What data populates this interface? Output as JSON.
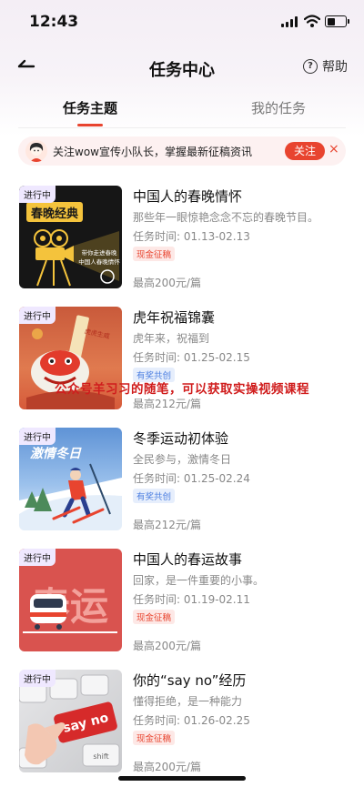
{
  "status": {
    "time": "12:43"
  },
  "header": {
    "title": "任务中心",
    "help_label": "帮助"
  },
  "tabs": [
    {
      "label": "任务主题"
    },
    {
      "label": "我的任务"
    }
  ],
  "banner": {
    "text": "关注wow宣传小队长，掌握最新征稿资讯",
    "follow_label": "关注",
    "close": "×"
  },
  "overlay_text": "公众号羊习习的随笔，可以获取实操视频课程",
  "tasks": [
    {
      "status": "进行中",
      "title": "中国人的春晚情怀",
      "desc": "那些年一眼惊艳念念不忘的春晚节目。",
      "date": "任务时间: 01.13-02.13",
      "tag": "现金征稿",
      "price": "最高200元/篇",
      "thumb_title": "春晚经典",
      "thumb_sub": "带你走进春晚\n中国人春晚情怀"
    },
    {
      "status": "进行中",
      "title": "虎年祝福锦囊",
      "desc": "虎年来，祝福到",
      "date": "任务时间: 01.25-02.15",
      "tag": "有奖共创",
      "price": "最高212元/篇",
      "thumb_title": "虎虎生威"
    },
    {
      "status": "进行中",
      "title": "冬季运动初体验",
      "desc": "全民参与，激情冬日",
      "date": "任务时间: 01.25-02.24",
      "tag": "有奖共创",
      "price": "最高212元/篇",
      "thumb_title": "激情冬日"
    },
    {
      "status": "进行中",
      "title": "中国人的春运故事",
      "desc": "回家，是一件重要的小事。",
      "date": "任务时间: 01.19-02.11",
      "tag": "现金征稿",
      "price": "最高200元/篇",
      "thumb_title": "春运"
    },
    {
      "status": "进行中",
      "title": "你的“say no”经历",
      "desc": "懂得拒绝，是一种能力",
      "date": "任务时间: 01.26-02.25",
      "tag": "现金征稿",
      "price": "最高200元/篇",
      "thumb_title": "say no",
      "thumb_sub": "shift"
    }
  ]
}
